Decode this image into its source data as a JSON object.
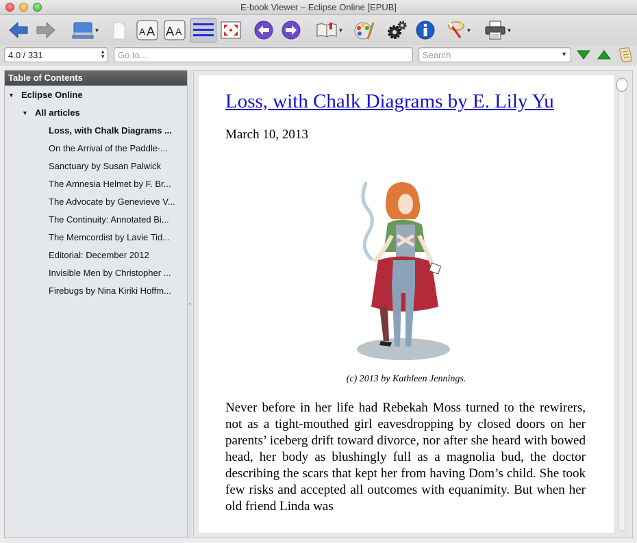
{
  "window": {
    "title": "E-book Viewer – Eclipse Online [EPUB]"
  },
  "toolbar": {
    "buttons": [
      {
        "name": "back",
        "icon": "arrow-left-icon"
      },
      {
        "name": "forward",
        "icon": "arrow-right-icon"
      },
      {
        "name": "open",
        "icon": "open-book-stack-icon"
      },
      {
        "name": "copy",
        "icon": "copy-page-icon"
      },
      {
        "name": "font-larger",
        "icon": "font-increase-icon"
      },
      {
        "name": "font-smaller",
        "icon": "font-decrease-icon"
      },
      {
        "name": "toc",
        "icon": "table-of-contents-icon"
      },
      {
        "name": "fullscreen",
        "icon": "fullscreen-icon"
      },
      {
        "name": "prev-page",
        "icon": "circle-arrow-left-icon"
      },
      {
        "name": "next-page",
        "icon": "circle-arrow-right-icon"
      },
      {
        "name": "bookmarks",
        "icon": "bookmark-book-icon"
      },
      {
        "name": "theme",
        "icon": "palette-icon"
      },
      {
        "name": "preferences",
        "icon": "gear-icon"
      },
      {
        "name": "metadata",
        "icon": "info-icon"
      },
      {
        "name": "reference-mode",
        "icon": "magic-wand-icon"
      },
      {
        "name": "print",
        "icon": "printer-icon"
      }
    ]
  },
  "search_row": {
    "position_value": "4.0 / 331",
    "goto_placeholder": "Go to...",
    "search_placeholder": "Search",
    "icons": [
      "find-next-icon",
      "find-previous-icon",
      "scroll-icon"
    ]
  },
  "toc": {
    "header": "Table of Contents",
    "book": "Eclipse Online",
    "section": "All articles",
    "items": [
      "Loss, with Chalk Diagrams ...",
      "On the Arrival of the Paddle-...",
      "Sanctuary by Susan Palwick",
      "The Amnesia Helmet by F. Br...",
      "The Advocate by Genevieve V...",
      "The Continuity: Annotated Bi...",
      "The Memcordist by Lavie Tid...",
      "Editorial: December 2012",
      "Invisible Men by Christopher ...",
      "Firebugs by Nina Kiriki Hoffm..."
    ]
  },
  "article": {
    "title": "Loss, with Chalk Diagrams by E. Lily Yu",
    "date": "March 10, 2013",
    "caption": "(c) 2013 by Kathleen Jennings.",
    "body": "Never before in her life had Rebekah Moss turned to the rewirers, not as a tight-mouthed girl eavesdropping by closed doors on her parents’ iceberg drift toward divorce, nor after she heard with bowed head, her body as blushingly full as a magnolia bud, the doctor describing the scars that kept her from having Dom’s child. She took few risks and accepted all outcomes with equanimity. But when her old friend Linda was"
  },
  "colors": {
    "link": "#1a0dcc",
    "toc_header": "#555555",
    "nav_green": "#1e9a2a",
    "nav_purple": "#6b4bc9"
  }
}
